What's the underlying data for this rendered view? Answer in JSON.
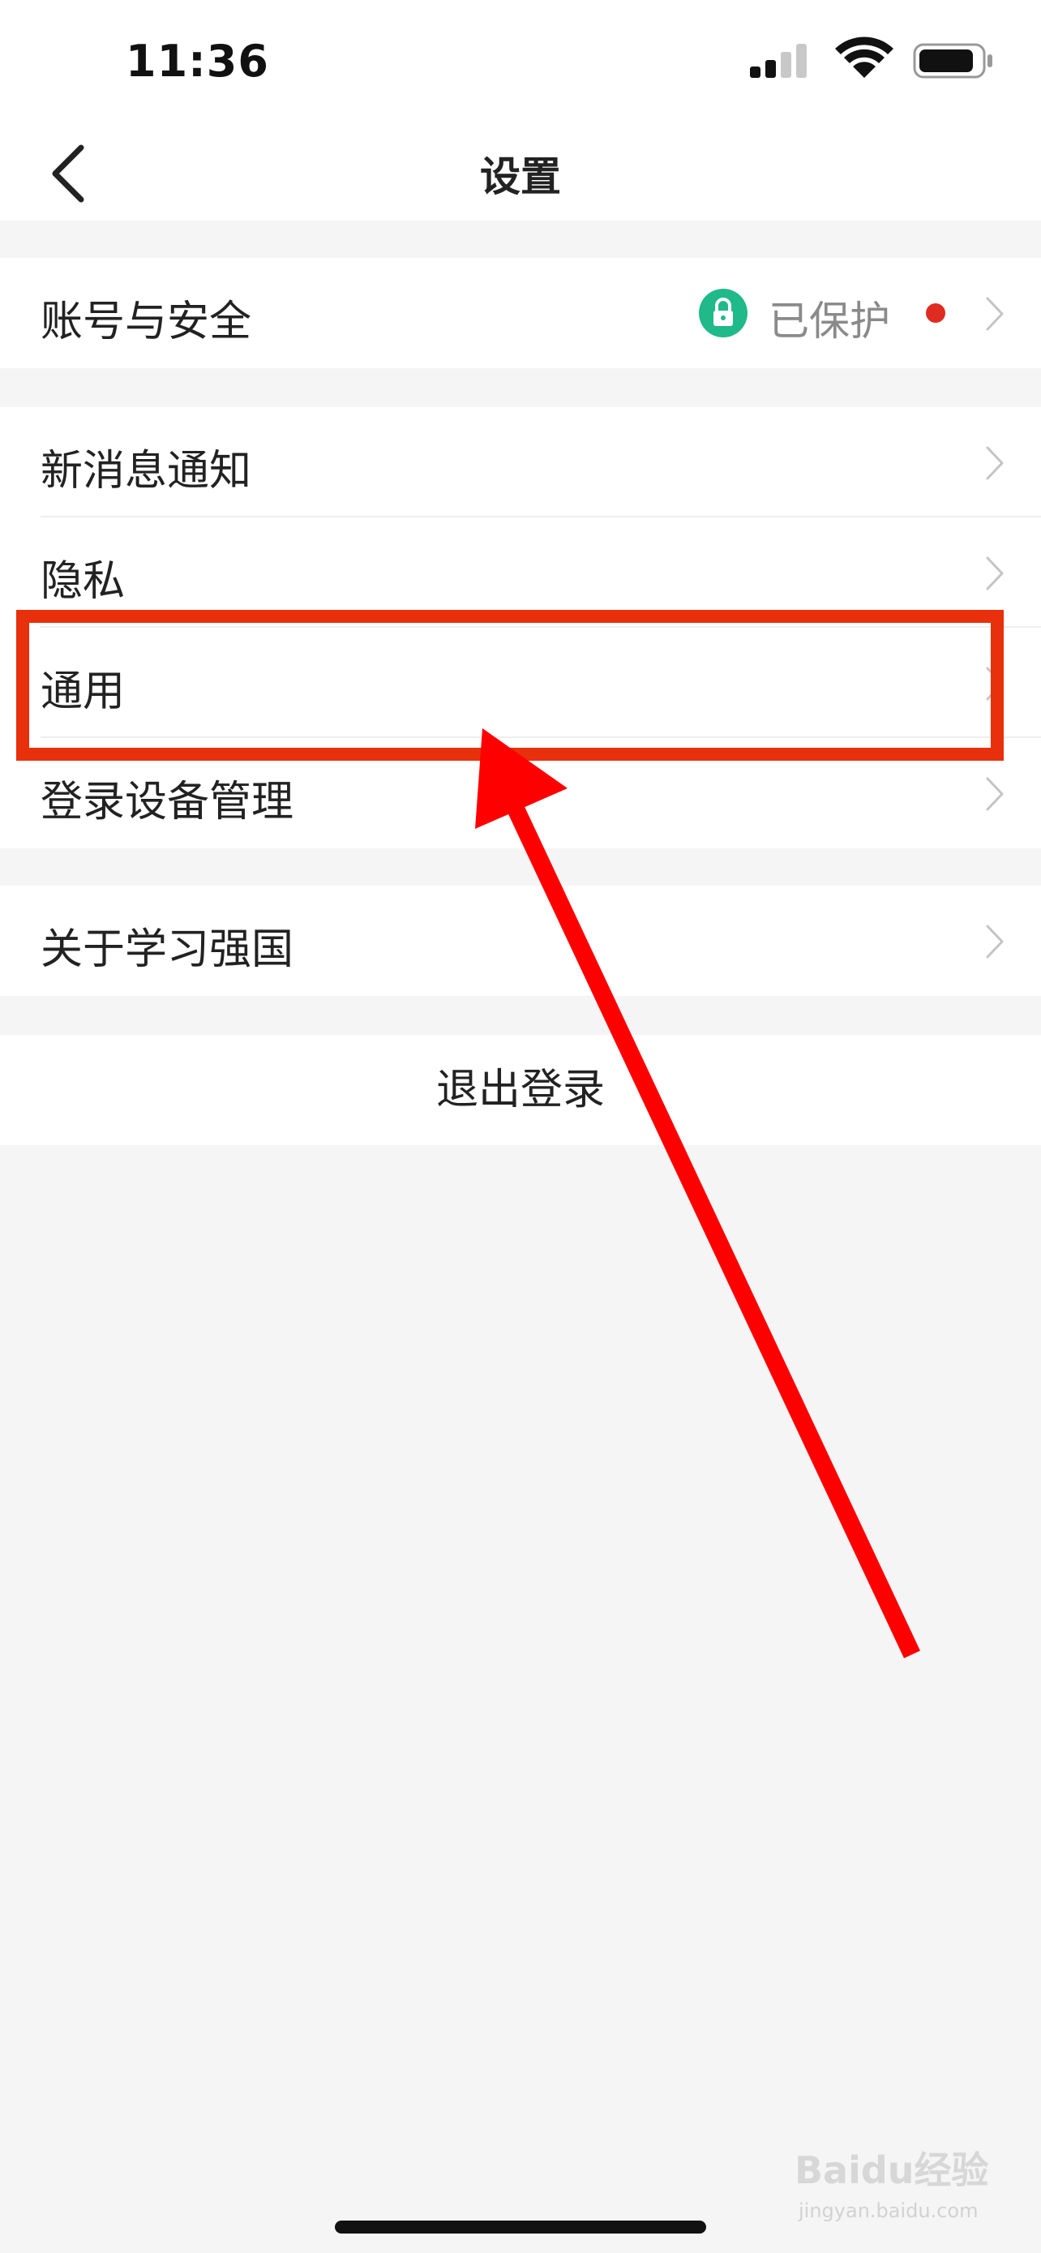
{
  "status_bar": {
    "time": "11:36"
  },
  "nav": {
    "title": "设置"
  },
  "groups": [
    {
      "items": [
        {
          "label": "账号与安全",
          "status": "已保护"
        }
      ]
    },
    {
      "items": [
        {
          "label": "新消息通知"
        },
        {
          "label": "隐私"
        },
        {
          "label": "通用"
        },
        {
          "label": "登录设备管理"
        }
      ]
    },
    {
      "items": [
        {
          "label": "关于学习强国"
        }
      ]
    }
  ],
  "logout": {
    "label": "退出登录"
  },
  "annotation": {
    "highlight_color": "#e8300d",
    "arrow_color": "#ff0000"
  },
  "watermark": {
    "brand": "Baidu经验",
    "url": "jingyan.baidu.com"
  },
  "colors": {
    "accent_green": "#20b98a",
    "red_dot": "#e02b20"
  }
}
